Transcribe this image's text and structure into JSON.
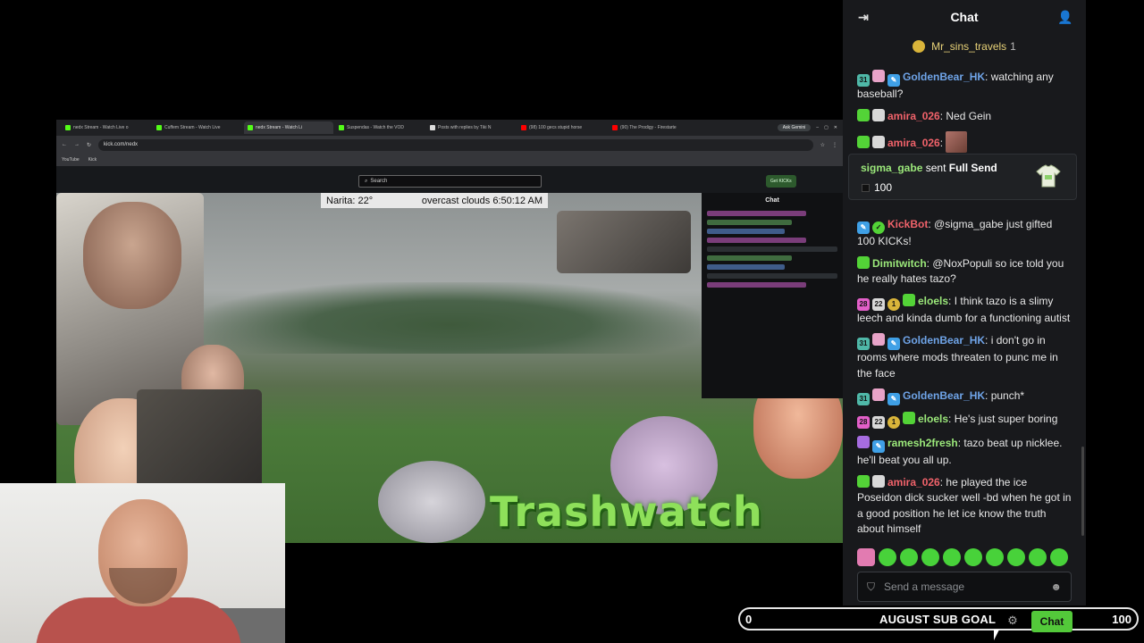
{
  "browser": {
    "tabs": [
      "nedx Stream - Watch Live o",
      "Cuffem Stream - Watch Live",
      "nedx Stream - Watch Li",
      "Suspendas - Watch the VOD",
      "Posts with replies by Tiki N",
      "(98) 100 gecs stupid horse",
      "(90) The Prodigy - Firestarte"
    ],
    "gemini_button": "Ask Gemini",
    "url": "kick.com/nedx",
    "bookmarks": [
      "YouTube",
      "Kick"
    ],
    "search_placeholder": "Search",
    "get_kicks": "Get KICKs"
  },
  "stream": {
    "weather": {
      "location": "Narita: 22°",
      "conditions": "overcast clouds 6:50:12 AM"
    },
    "inner_chat_title": "Chat",
    "logo_text": "Trashwatch"
  },
  "chat": {
    "title": "Chat",
    "pinned": {
      "user": "Mr_sins_travels",
      "count": "1"
    },
    "messages": [
      {
        "user": "GoldenBear_HK",
        "user_color": "#6fa4e8",
        "badges": [
          "31",
          "pink",
          "mod"
        ],
        "text": "watching any baseball?"
      },
      {
        "user": "amira_026",
        "user_color": "#f0626a",
        "badges": [
          "gift",
          "og"
        ],
        "text": "Ned Gein"
      },
      {
        "user": "amira_026",
        "user_color": "#f0626a",
        "badges": [
          "gift",
          "og"
        ],
        "text": "",
        "emote": true
      },
      {
        "user": "KickBot",
        "user_color": "#f0626a",
        "badges": [
          "mod",
          "ver"
        ],
        "text": "@sigma_gabe just gifted 100 KICKs!"
      },
      {
        "user": "Dimitwitch",
        "user_color": "#9be87a",
        "badges": [
          "gift"
        ],
        "text": "@NoxPopuli so ice told you he really hates tazo?"
      },
      {
        "user": "eloels",
        "user_color": "#9be87a",
        "badges": [
          "28",
          "22",
          "coin",
          "gift"
        ],
        "text": "I think tazo is a slimy leech and kinda dumb for a functioning autist"
      },
      {
        "user": "GoldenBear_HK",
        "user_color": "#6fa4e8",
        "badges": [
          "31",
          "pink",
          "mod"
        ],
        "text": "i don't go in rooms where mods threaten to punc me in the face"
      },
      {
        "user": "GoldenBear_HK",
        "user_color": "#6fa4e8",
        "badges": [
          "31",
          "pink",
          "mod"
        ],
        "text": "punch*"
      },
      {
        "user": "eloels",
        "user_color": "#9be87a",
        "badges": [
          "28",
          "22",
          "coin",
          "gift"
        ],
        "text": "He's just super boring"
      },
      {
        "user": "ramesh2fresh",
        "user_color": "#9be87a",
        "badges": [
          "bot",
          "mod"
        ],
        "text": "tazo beat up nicklee. he'll beat you all up."
      },
      {
        "user": "amira_026",
        "user_color": "#f0626a",
        "badges": [
          "gift",
          "og"
        ],
        "text": "he played the ice Poseidon dick sucker well -bd when he got in a good position he let ice know the truth about himself"
      }
    ],
    "gift_card": {
      "user": "sigma_gabe",
      "action": "sent",
      "item": "Full Send",
      "amount": "100"
    },
    "input_placeholder": "Send a message",
    "colors": {
      "accent": "#53c93a",
      "bg": "#18191c"
    }
  },
  "sub_goal": {
    "start": "0",
    "label": "AUGUST SUB GOAL",
    "end": "100",
    "chat_button": "Chat"
  }
}
